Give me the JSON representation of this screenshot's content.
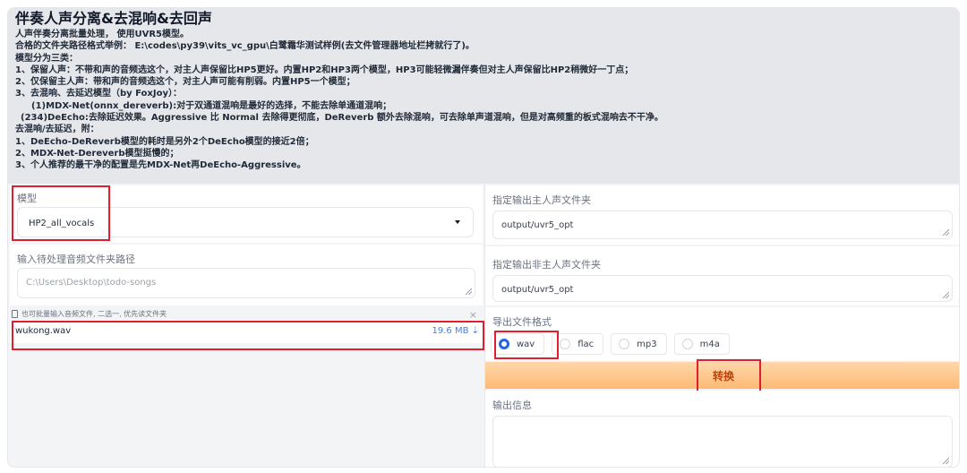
{
  "description": {
    "title": "伴奏人声分离&去混响&去回声",
    "lines": [
      "人声伴奏分离批量处理， 使用UVR5模型。",
      "合格的文件夹路径格式举例： E:\\codes\\py39\\vits_vc_gpu\\白鹭霜华测试样例(去文件管理器地址栏拷就行了)。",
      "模型分为三类：",
      "1、保留人声：不带和声的音频选这个，对主人声保留比HP5更好。内置HP2和HP3两个模型，HP3可能轻微漏伴奏但对主人声保留比HP2稍微好一丁点；",
      "2、仅保留主人声：带和声的音频选这个，对主人声可能有削弱。内置HP5一个模型；",
      "3、去混响、去延迟模型（by FoxJoy）：",
      "(1)MDX-Net(onnx_dereverb):对于双通道混响是最好的选择，不能去除单通道混响；",
      "(234)DeEcho:去除延迟效果。Aggressive 比 Normal 去除得更彻底，DeReverb 额外去除混响，可去除单声道混响，但是对高频重的板式混响去不干净。",
      "去混响/去延迟，附：",
      "1、DeEcho-DeReverb模型的耗时是另外2个DeEcho模型的接近2倍；",
      "2、MDX-Net-Dereverb模型挺慢的；",
      "3、个人推荐的最干净的配置是先MDX-Net再DeEcho-Aggressive。"
    ]
  },
  "model": {
    "label": "模型",
    "selected": "HP2_all_vocals"
  },
  "input_dir": {
    "label": "输入待处理音频文件夹路径",
    "placeholder": "C:\\Users\\Desktop\\todo-songs"
  },
  "file_upload": {
    "hint": "也可批量输入音频文件, 二选一, 优先读文件夹",
    "close": "×",
    "file_name": "wukong.wav",
    "file_size": "19.6 MB ⇣"
  },
  "vocal_output": {
    "label": "指定输出主人声文件夹",
    "value": "output/uvr5_opt"
  },
  "inst_output": {
    "label": "指定输出非主人声文件夹",
    "value": "output/uvr5_opt"
  },
  "format": {
    "label": "导出文件格式",
    "options": [
      "wav",
      "flac",
      "mp3",
      "m4a"
    ],
    "selected": "wav"
  },
  "convert_label": "转换",
  "output_info": {
    "label": "输出信息",
    "value": ""
  },
  "colors": {
    "highlight": "#e11d2e",
    "accent": "#2563eb",
    "button_text": "#c2410c"
  }
}
